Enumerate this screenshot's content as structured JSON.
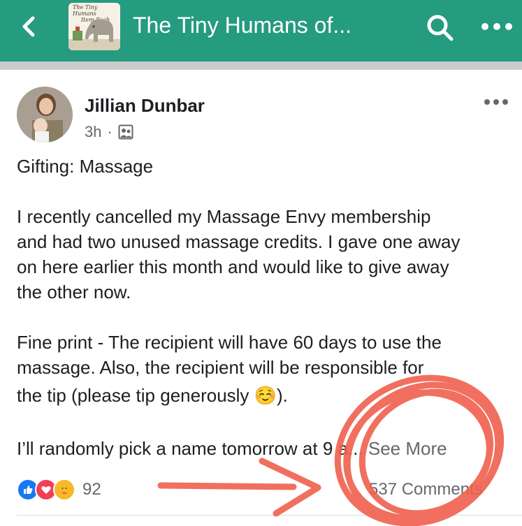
{
  "header": {
    "group_title": "The Tiny Humans of...",
    "group_thumb_text_1": "The Tiny Humans",
    "group_thumb_text_2": "Item Exch",
    "icons": [
      "back-chevron-icon",
      "search-icon",
      "more-horizontal-icon"
    ],
    "color": "#259b7f"
  },
  "post": {
    "author": "Jillian Dunbar",
    "time": "3h",
    "separator": "·",
    "audience_icon": "group-audience-icon",
    "lines": [
      "Gifting: Massage",
      "",
      "I recently cancelled my Massage Envy membership",
      "and had two unused massage credits. I gave one away",
      "on here earlier this month and would like to give away",
      "the other now.",
      "",
      "Fine print - The recipient will have 60 days to use the",
      "massage. Also, the recipient will be responsible for",
      "the tip (please tip generously ☺️).",
      "",
      "I’ll randomly pick a name tomorrow at 9 a... "
    ],
    "see_more": "See More"
  },
  "footer": {
    "reaction_count": "92",
    "comments": "537 Comments",
    "reaction_icons": [
      "like-reaction-icon",
      "love-reaction-icon",
      "care-reaction-icon"
    ]
  }
}
